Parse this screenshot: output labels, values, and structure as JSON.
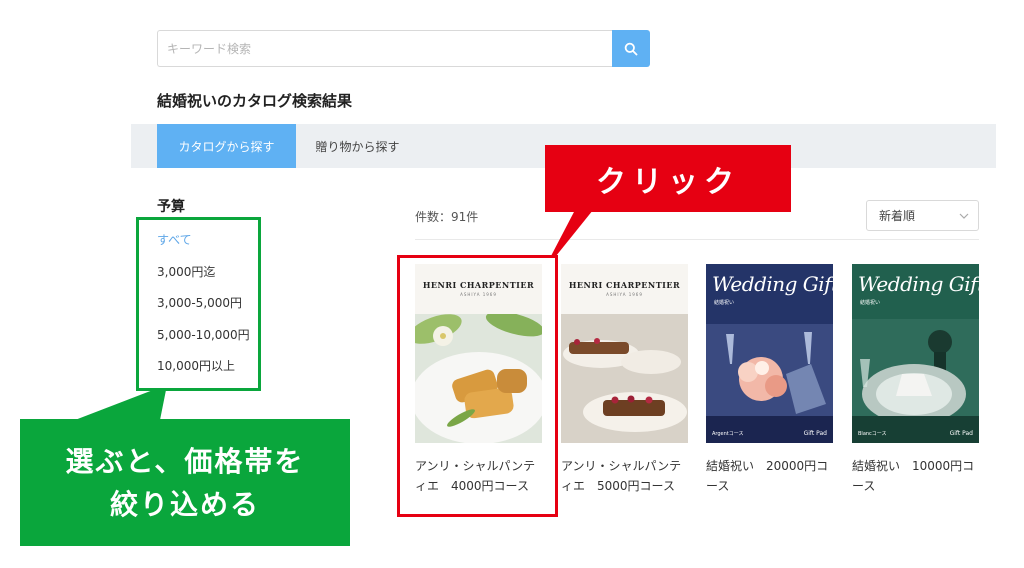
{
  "search": {
    "placeholder": "キーワード検索",
    "button_icon": "search-icon"
  },
  "results_title": "結婚祝いのカタログ検索結果",
  "tabs": [
    {
      "label": "カタログから探す",
      "active": true
    },
    {
      "label": "贈り物から探す",
      "active": false
    }
  ],
  "budget": {
    "heading": "予算",
    "items": [
      {
        "label": "すべて",
        "selected": true
      },
      {
        "label": "3,000円迄",
        "selected": false
      },
      {
        "label": "3,000-5,000円",
        "selected": false
      },
      {
        "label": "5,000-10,000円",
        "selected": false
      },
      {
        "label": "10,000円以上",
        "selected": false
      }
    ]
  },
  "results": {
    "count_label": "件数：91件",
    "sort": {
      "selected": "新着順",
      "icon": "chevron-down-icon"
    }
  },
  "products": [
    {
      "name": "アンリ・シャルパンティエ　4000円コース",
      "cover": {
        "brand": "HENRI CHARPENTIER",
        "sub": "ASHIYA 1969"
      }
    },
    {
      "name": "アンリ・シャルパンティエ　5000円コース",
      "cover": {
        "brand": "HENRI CHARPENTIER",
        "sub": "ASHIYA 1969"
      }
    },
    {
      "name": "結婚祝い　20000円コース",
      "cover": {
        "title": "Wedding Gift",
        "sub": "結婚祝い",
        "course": "Argentコース",
        "logo": "Gift Pad"
      }
    },
    {
      "name": "結婚祝い　10000円コース",
      "cover": {
        "title": "Wedding Gift",
        "sub": "結婚祝い",
        "course": "Blancコース",
        "logo": "Gift Pad"
      }
    }
  ],
  "annotations": {
    "click_callout": "クリック",
    "filter_callout_line1": "選ぶと、価格帯を",
    "filter_callout_line2": "絞り込める",
    "red": "#e60012",
    "green": "#0aa63c",
    "accent_blue": "#5fb1f3"
  }
}
